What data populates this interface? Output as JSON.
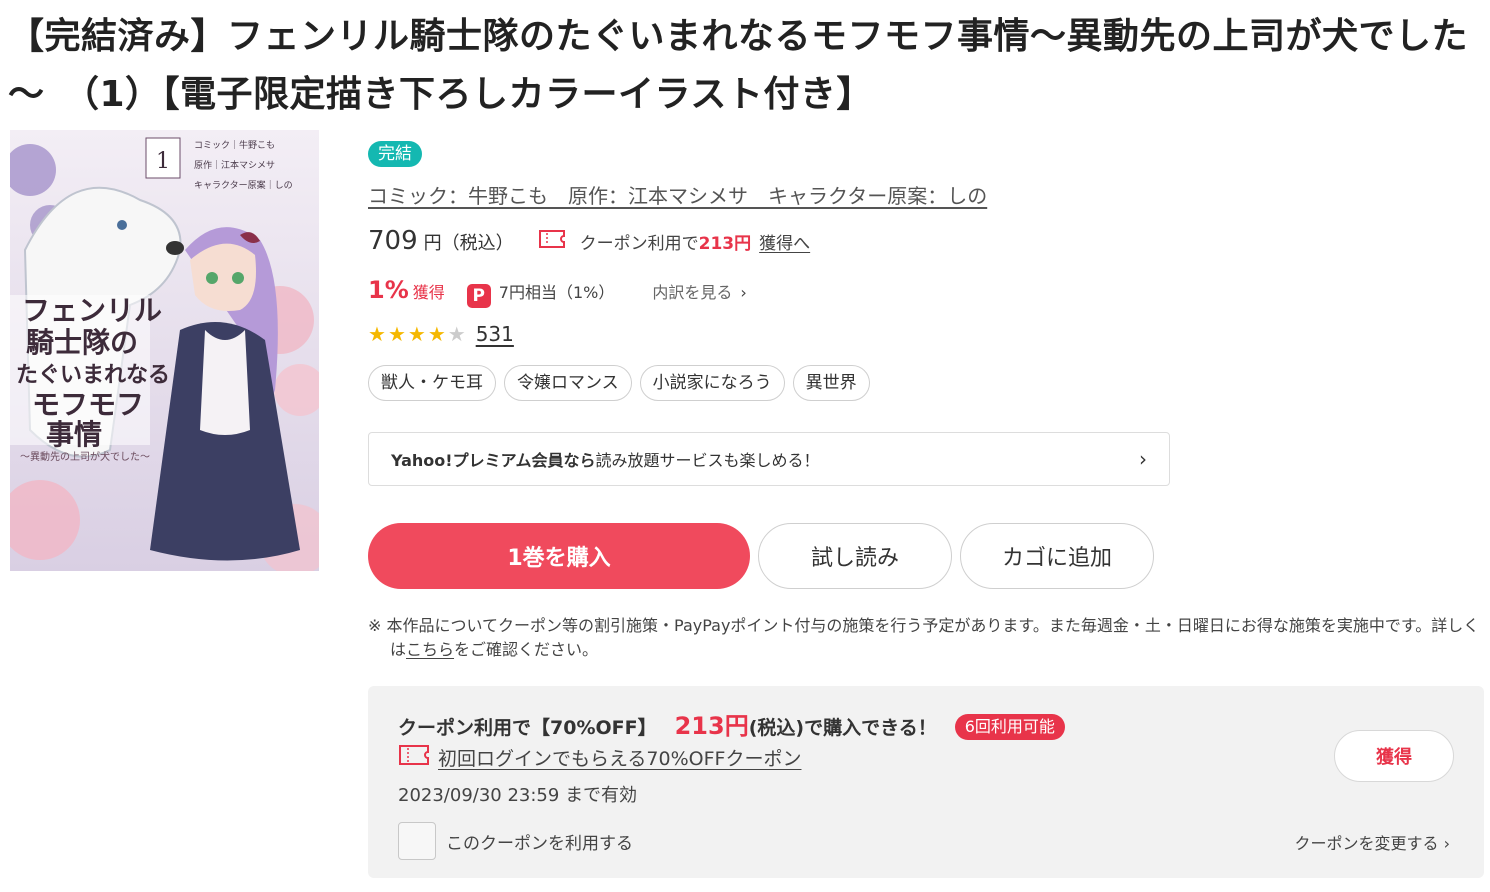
{
  "title": "【完結済み】フェンリル騎士隊のたぐいまれなるモフモフ事情～異動先の上司が犬でした～　（1）【電子限定描き下ろしカラーイラスト付き】",
  "cover": {
    "alt": "表紙画像",
    "vol_label": "1",
    "title_lines": [
      "フェンリル",
      "騎士隊の",
      "たぐいまれなる",
      "モフモフ",
      "事情"
    ],
    "subtitle": "～異動先の上司が犬でした～",
    "credit_lines": [
      "コミック｜牛野こも",
      "原作｜江本マシメサ",
      "キャラクター原案｜しの"
    ]
  },
  "status_badge": "完結",
  "authors": "コミック：牛野こも　原作：江本マシメサ　キャラクター原案：しの",
  "price": {
    "value": "709",
    "unit": "円（税込）",
    "coupon_prefix": "クーポン利用で",
    "coupon_amount": "213円",
    "coupon_get": "獲得へ"
  },
  "points": {
    "percent": "1%",
    "get_label": "獲得",
    "paypay_glyph": "P",
    "yen_equiv": "7円相当（1%）",
    "breakdown": "内訳を見る"
  },
  "rating": {
    "stars": 4,
    "max": 5,
    "review_count": "531"
  },
  "tags": [
    "獣人・ケモ耳",
    "令嬢ロマンス",
    "小説家になろう",
    "異世界"
  ],
  "yahoo": {
    "bold_text": "Yahoo!プレミアム会員なら",
    "text": "読み放題サービスも楽しめる！"
  },
  "buttons": {
    "buy": "1巻を購入",
    "trial": "試し読み",
    "cart": "カゴに追加"
  },
  "notice": {
    "prefix": "※ 本作品についてクーポン等の割引施策・PayPayポイント付与の施策を行う予定があります。また毎週金・土・日曜日にお得な施策を実施中です。詳しくは",
    "link": "こちら",
    "suffix": "をご確認ください。"
  },
  "coupon_panel": {
    "lead": "クーポン利用で【70%OFF】",
    "amount": "213円",
    "tail": "(税込)で購入できる！",
    "uses": "6回利用可能",
    "name": "初回ログインでもらえる70%OFFクーポン",
    "expire": "2023/09/30 23:59 まで有効",
    "get_button": "獲得",
    "use_checkbox": "このクーポンを利用する",
    "change": "クーポンを変更する"
  },
  "colors": {
    "accent": "#e8344a",
    "buy_button": "#f04a5d",
    "badge_teal": "#14b8b1",
    "star": "#f5b800"
  }
}
